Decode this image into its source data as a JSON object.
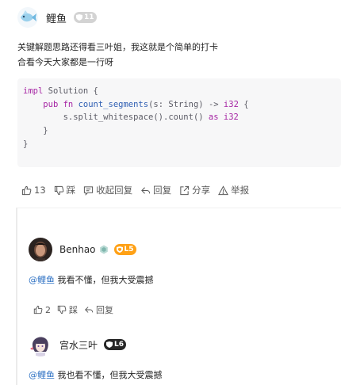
{
  "post": {
    "author": "鲤鱼",
    "level": "11",
    "text_line1": "关键解题思路还得看三叶姐，我这就是个简单的打卡",
    "text_line2": "合看今天大家都是一行呀",
    "code": {
      "line1_kw": "impl",
      "line1_rest": " Solution {",
      "line2_kw1": "pub",
      "line2_kw2": "fn",
      "line2_fn": "count_segments",
      "line2_params": "(s: String) -> ",
      "line2_type": "i32",
      "line2_end": " {",
      "line3_expr": "s.split_whitespace().count() ",
      "line3_kw": "as",
      "line3_type": " i32",
      "line4": "}",
      "line5": "}"
    },
    "actions": {
      "likes": "13",
      "dislike": "踩",
      "collapse": "收起回复",
      "reply": "回复",
      "share": "分享",
      "report": "举报"
    }
  },
  "replies": [
    {
      "author": "Benhao",
      "level": "L5",
      "mention": "@鲤鱼",
      "text": " 我看不懂，但我大受震撼",
      "likes": "2",
      "dislike": "踩",
      "reply": "回复"
    },
    {
      "author": "宫水三叶",
      "level": "L6",
      "mention": "@鲤鱼",
      "text": " 我也看不懂，但我大受震撼"
    }
  ],
  "colors": {
    "accent_orange": "#ffa116",
    "mention_blue": "#2f72c4",
    "keyword_purple": "#a626a4",
    "function_blue": "#2f5fb3"
  }
}
